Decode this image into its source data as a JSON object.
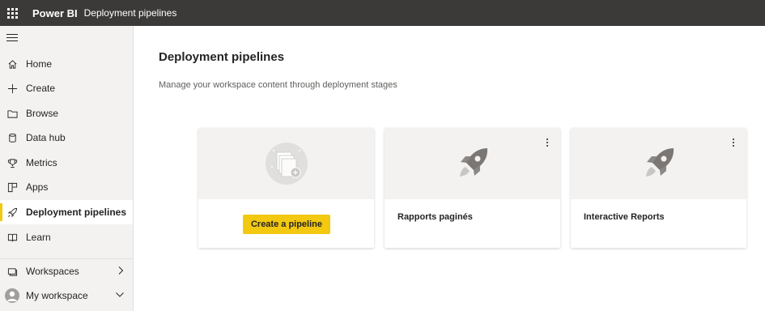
{
  "header": {
    "brand": "Power BI",
    "breadcrumb": "Deployment pipelines"
  },
  "sidebar": {
    "items": [
      {
        "label": "Home",
        "icon": "home-icon"
      },
      {
        "label": "Create",
        "icon": "plus-icon"
      },
      {
        "label": "Browse",
        "icon": "folder-icon"
      },
      {
        "label": "Data hub",
        "icon": "database-icon"
      },
      {
        "label": "Metrics",
        "icon": "trophy-icon"
      },
      {
        "label": "Apps",
        "icon": "apps-icon"
      },
      {
        "label": "Deployment pipelines",
        "icon": "rocket-icon",
        "active": true
      },
      {
        "label": "Learn",
        "icon": "book-icon"
      },
      {
        "label": "Workspaces",
        "icon": "workspaces-icon"
      },
      {
        "label": "My workspace",
        "icon": "avatar"
      }
    ]
  },
  "main": {
    "title": "Deployment pipelines",
    "subtitle": "Manage your workspace content through deployment stages",
    "create_button": "Create a pipeline",
    "pipelines": [
      {
        "name": "Rapports paginés"
      },
      {
        "name": "Interactive Reports"
      }
    ]
  },
  "colors": {
    "topbar": "#3b3a39",
    "accent": "#f2c811",
    "sidebar_bg": "#f3f2f1"
  }
}
